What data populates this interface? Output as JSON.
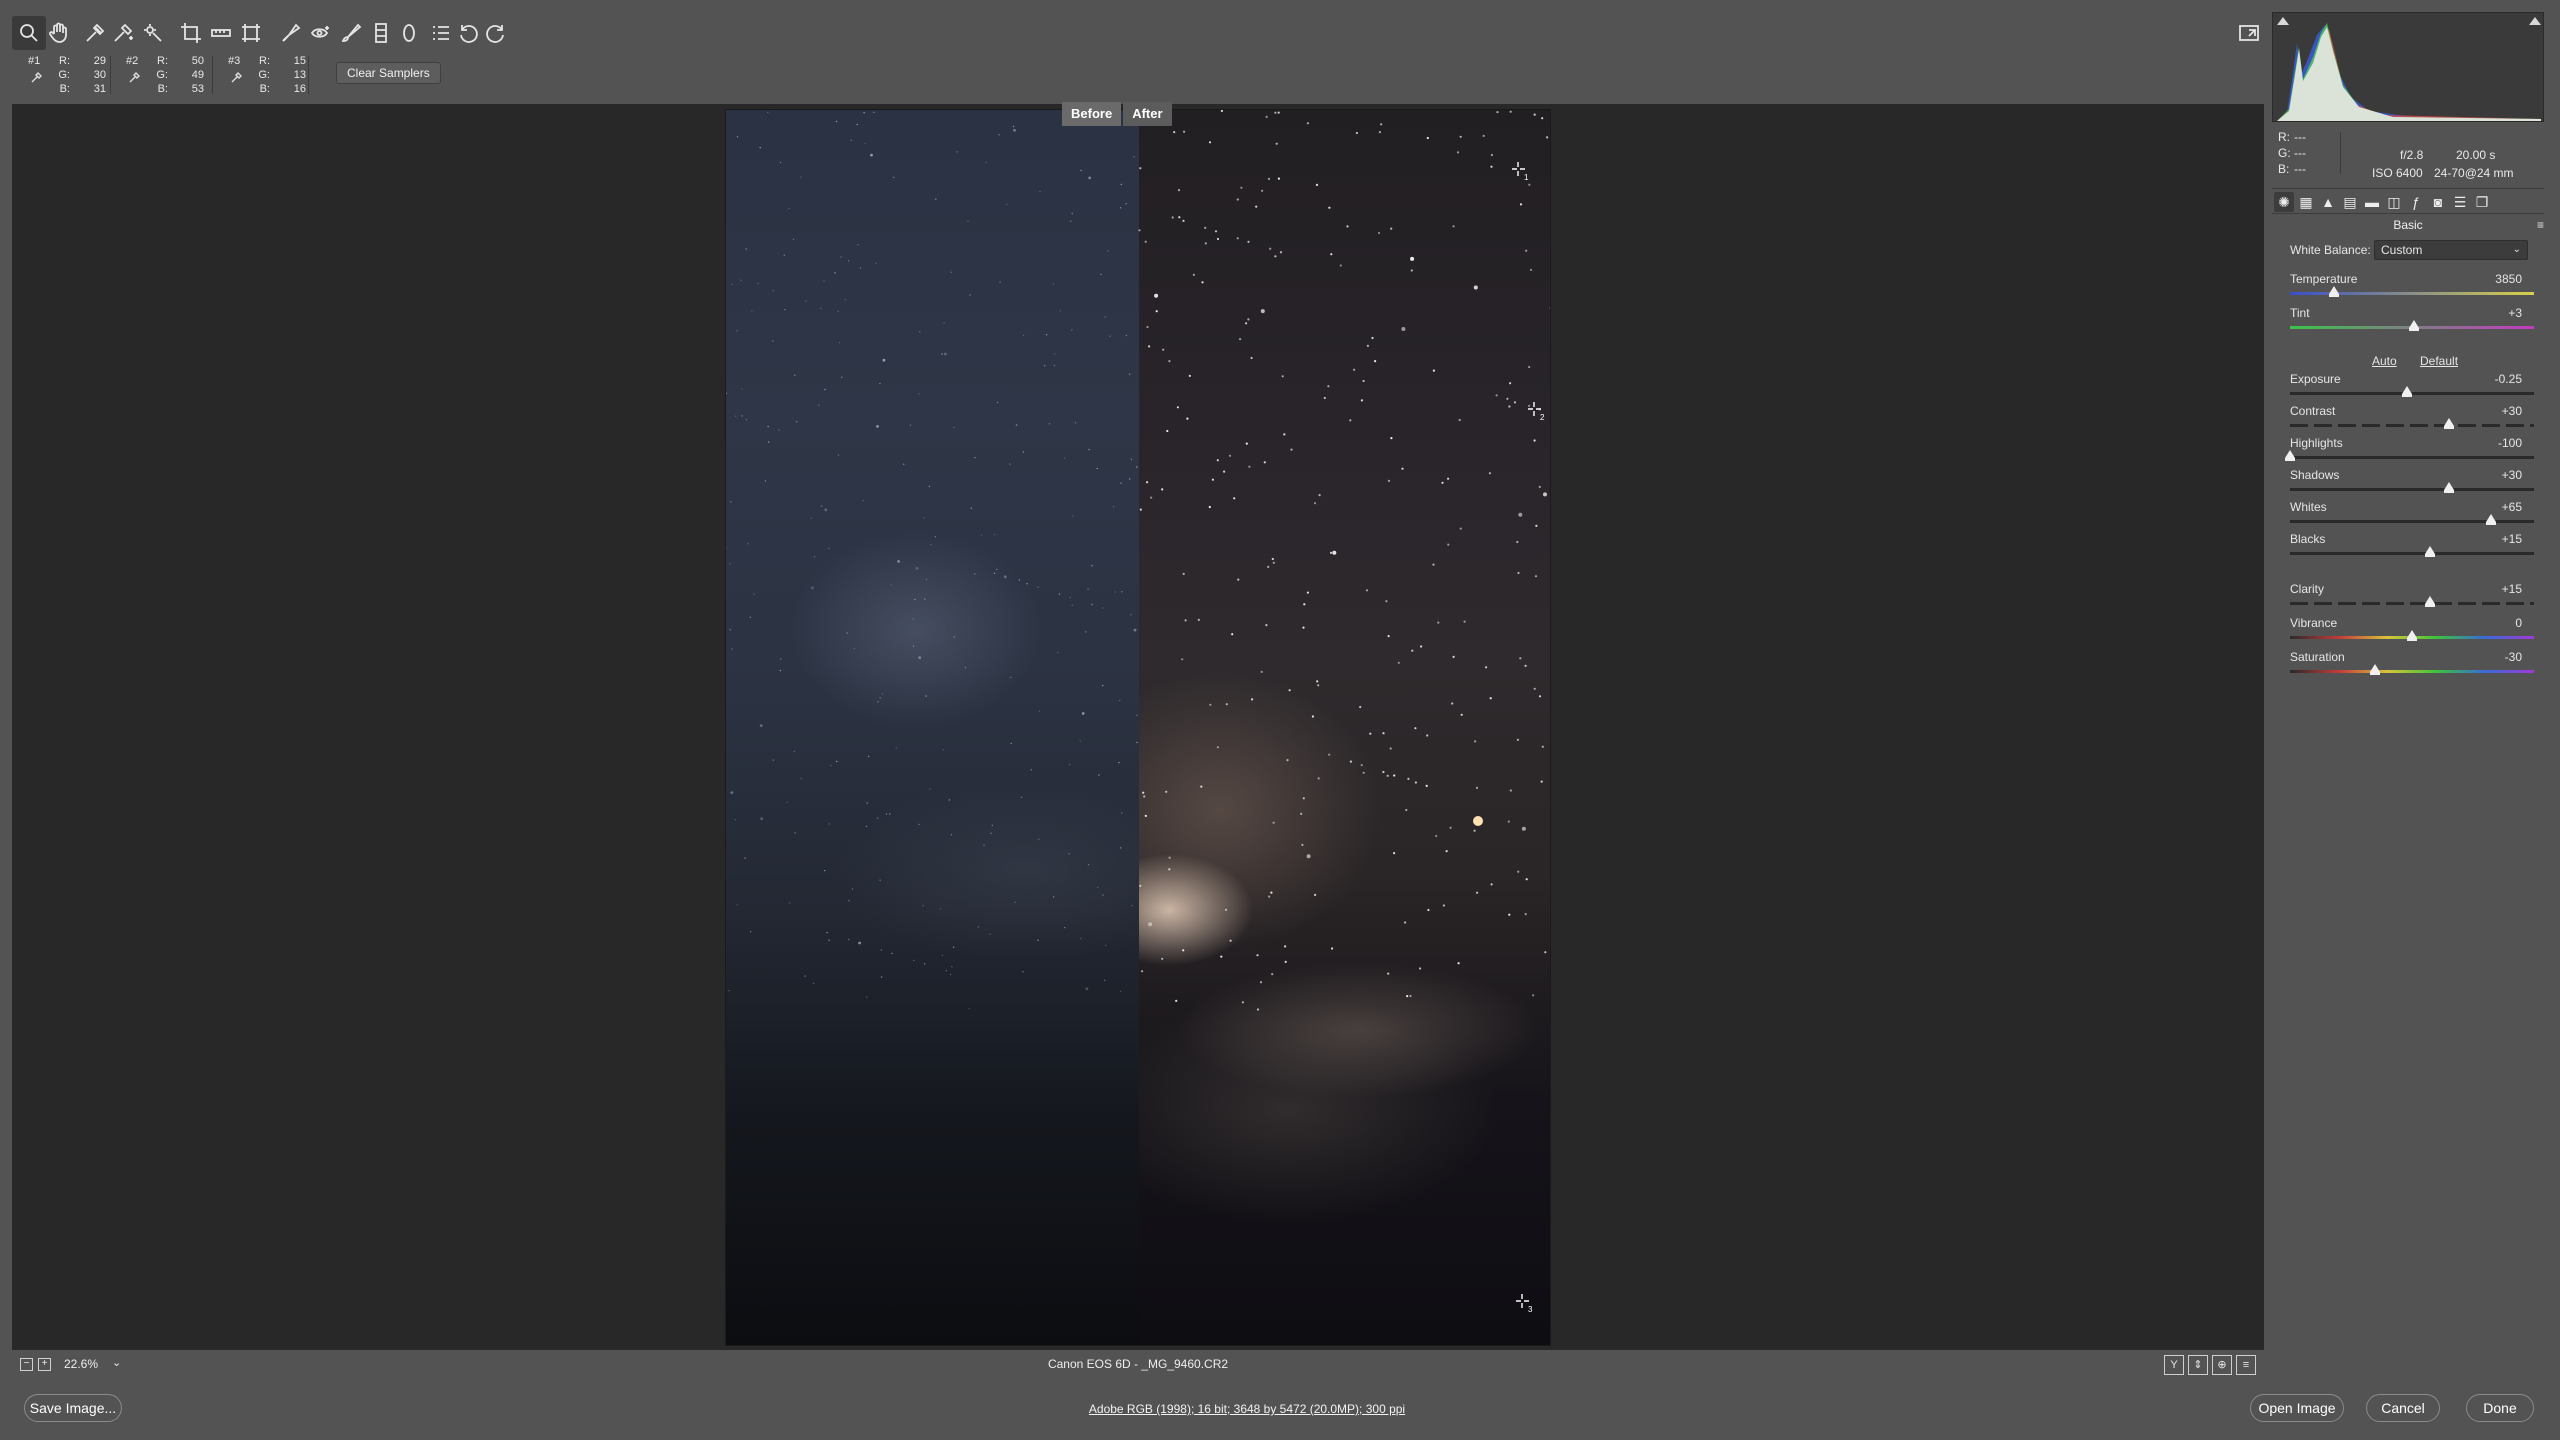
{
  "toolbar": {
    "tools": [
      "zoom-tool",
      "hand-tool",
      "white-balance-tool",
      "color-sampler-tool",
      "targeted-adjustment-tool",
      "crop-tool",
      "straighten-tool",
      "transform-tool",
      "spot-removal-tool",
      "red-eye-tool",
      "adjustment-brush-tool",
      "graduated-filter-tool",
      "radial-filter-tool",
      "preferences-tool",
      "rotate-ccw-tool",
      "rotate-cw-tool"
    ]
  },
  "samplers": [
    {
      "id": "#1",
      "r_label": "R:",
      "g_label": "G:",
      "b_label": "B:",
      "r": "29",
      "g": "30",
      "b": "31"
    },
    {
      "id": "#2",
      "r_label": "R:",
      "g_label": "G:",
      "b_label": "B:",
      "r": "50",
      "g": "49",
      "b": "53"
    },
    {
      "id": "#3",
      "r_label": "R:",
      "g_label": "G:",
      "b_label": "B:",
      "r": "15",
      "g": "13",
      "b": "16"
    }
  ],
  "clear_samplers_label": "Clear Samplers",
  "preview": {
    "before_label": "Before",
    "after_label": "After",
    "marker_labels": [
      "1",
      "2",
      "3"
    ]
  },
  "status": {
    "zoom_out": "−",
    "zoom_in": "+",
    "zoom": "22.6%",
    "zoom_caret": "⌄",
    "filename": "Canon EOS 6D  -  _MG_9460.CR2",
    "view_buttons": [
      "Y",
      "⇕",
      "⊕",
      "≡"
    ]
  },
  "bottom": {
    "save_image": "Save Image...",
    "workflow": "Adobe RGB (1998); 16 bit; 3648 by 5472 (20.0MP); 300 ppi",
    "open_image": "Open Image",
    "cancel": "Cancel",
    "done": "Done"
  },
  "info": {
    "r_label": "R:",
    "g_label": "G:",
    "b_label": "B:",
    "r": "---",
    "g": "---",
    "b": "---",
    "aperture": "f/2.8",
    "shutter": "20.00 s",
    "iso": "ISO 6400",
    "lens": "24-70@24 mm"
  },
  "panel": {
    "tabs": [
      "basic-tab",
      "tone-curve-tab",
      "detail-tab",
      "hsl-tab",
      "split-toning-tab",
      "lens-corrections-tab",
      "effects-tab",
      "camera-calibration-tab",
      "presets-tab",
      "snapshots-tab"
    ],
    "title": "Basic",
    "menu_icon": "≡",
    "white_balance_label": "White Balance:",
    "white_balance_value": "Custom",
    "auto_label": "Auto",
    "default_label": "Default",
    "sliders": [
      {
        "label": "Temperature",
        "value": "3850",
        "level": 0.18
      },
      {
        "label": "Tint",
        "value": "+3",
        "level": 0.51
      },
      {
        "label": "Exposure",
        "value": "-0.25",
        "level": 0.48
      },
      {
        "label": "Contrast",
        "value": "+30",
        "level": 0.65
      },
      {
        "label": "Highlights",
        "value": "-100",
        "level": 0.0
      },
      {
        "label": "Shadows",
        "value": "+30",
        "level": 0.65
      },
      {
        "label": "Whites",
        "value": "+65",
        "level": 0.825
      },
      {
        "label": "Blacks",
        "value": "+15",
        "level": 0.575
      },
      {
        "label": "Clarity",
        "value": "+15",
        "level": 0.575
      },
      {
        "label": "Vibrance",
        "value": "0",
        "level": 0.5
      },
      {
        "label": "Saturation",
        "value": "-30",
        "level": 0.35
      }
    ]
  },
  "colors": {
    "chrome": "#535353",
    "preview_bg": "#282828",
    "accent_text": "#e6e6e6"
  }
}
